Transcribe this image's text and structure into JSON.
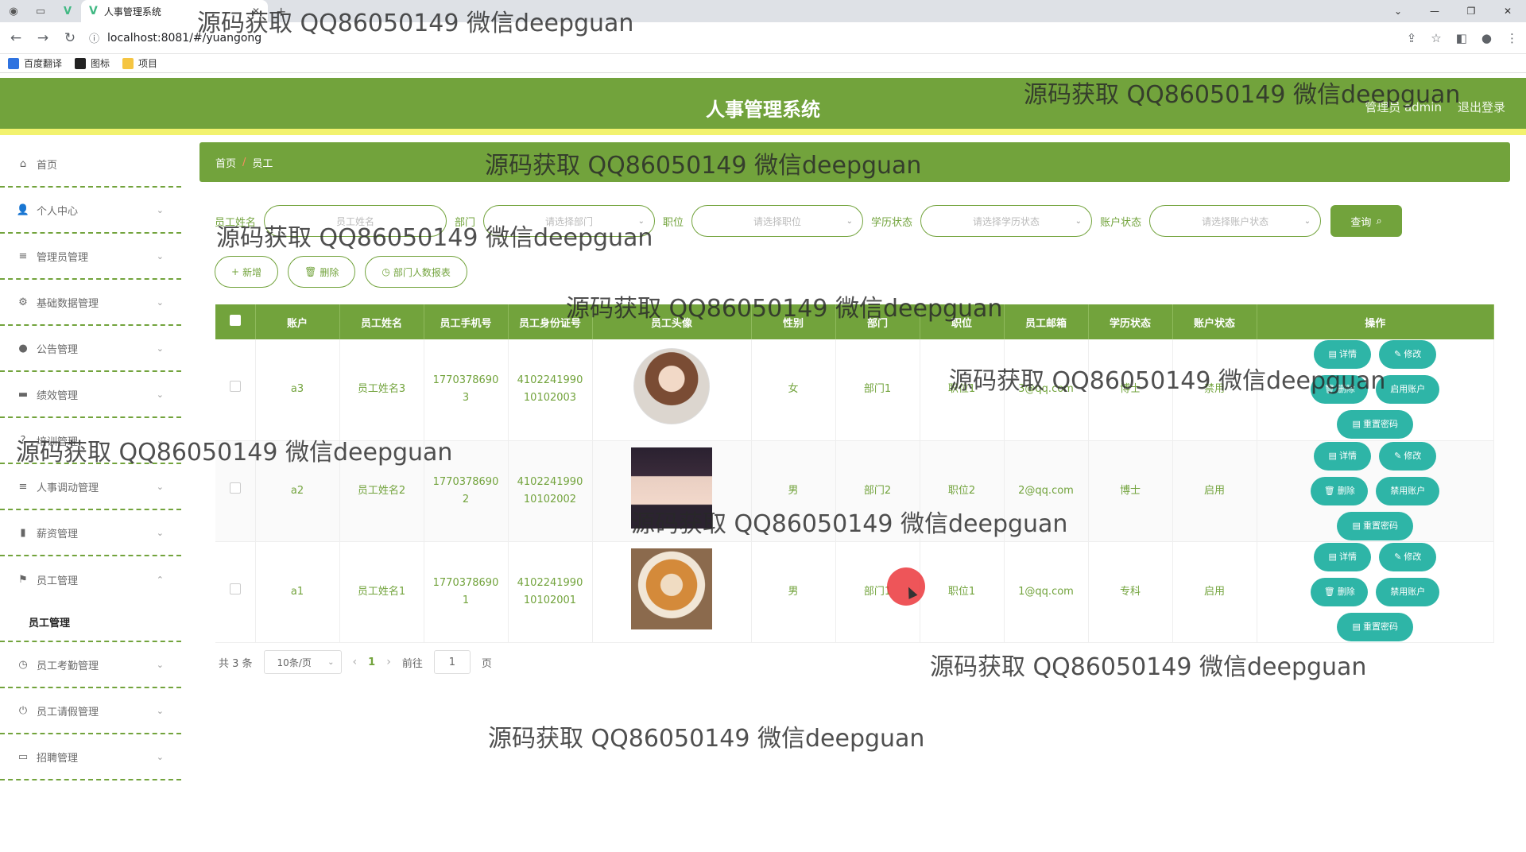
{
  "browser": {
    "tab_title": "人事管理系统",
    "url": "localhost:8081/#/yuangong",
    "bookmarks": [
      "百度翻译",
      "图标",
      "项目"
    ]
  },
  "header": {
    "title": "人事管理系统",
    "admin_label": "管理员 admin",
    "logout_label": "退出登录"
  },
  "sidebar": {
    "items": [
      {
        "label": "首页",
        "icon": "home-icon"
      },
      {
        "label": "个人中心",
        "icon": "user-icon"
      },
      {
        "label": "管理员管理",
        "icon": "list-icon"
      },
      {
        "label": "基础数据管理",
        "icon": "settings-icon"
      },
      {
        "label": "公告管理",
        "icon": "pin-icon"
      },
      {
        "label": "绩效管理",
        "icon": "message-icon"
      },
      {
        "label": "培训管理",
        "icon": "help-icon"
      },
      {
        "label": "人事调动管理",
        "icon": "list-icon"
      },
      {
        "label": "薪资管理",
        "icon": "chart-icon"
      },
      {
        "label": "员工管理",
        "icon": "flag-icon"
      },
      {
        "label": "员工管理",
        "icon": ""
      },
      {
        "label": "员工考勤管理",
        "icon": "clock-icon"
      },
      {
        "label": "员工请假管理",
        "icon": "power-icon"
      },
      {
        "label": "招聘管理",
        "icon": "card-icon"
      }
    ]
  },
  "breadcrumb": {
    "home": "首页",
    "sep": "/",
    "current": "员工"
  },
  "filters": {
    "name_label": "员工姓名",
    "name_placeholder": "员工姓名",
    "dept_label": "部门",
    "dept_placeholder": "请选择部门",
    "position_label": "职位",
    "position_placeholder": "请选择职位",
    "edu_label": "学历状态",
    "edu_placeholder": "请选择学历状态",
    "account_label": "账户状态",
    "account_placeholder": "请选择账户状态",
    "query_label": "查询"
  },
  "actions": {
    "add": "新增",
    "delete": "删除",
    "dept_stats": "部门人数报表"
  },
  "table": {
    "headers": [
      "账户",
      "员工姓名",
      "员工手机号",
      "员工身份证号",
      "员工头像",
      "性别",
      "部门",
      "职位",
      "员工邮箱",
      "学历状态",
      "账户状态",
      "操作"
    ],
    "rows": [
      {
        "account": "a3",
        "name": "员工姓名3",
        "phone1": "1770378690",
        "phone2": "3",
        "id1": "4102241990",
        "id2": "10102003",
        "gender": "女",
        "dept": "部门1",
        "position": "职位1",
        "email": "3@qq.com",
        "edu": "博士",
        "status": "禁用",
        "toggle": "启用账户"
      },
      {
        "account": "a2",
        "name": "员工姓名2",
        "phone1": "1770378690",
        "phone2": "2",
        "id1": "4102241990",
        "id2": "10102002",
        "gender": "男",
        "dept": "部门2",
        "position": "职位2",
        "email": "2@qq.com",
        "edu": "博士",
        "status": "启用",
        "toggle": "禁用账户"
      },
      {
        "account": "a1",
        "name": "员工姓名1",
        "phone1": "1770378690",
        "phone2": "1",
        "id1": "4102241990",
        "id2": "10102001",
        "gender": "男",
        "dept": "部门1",
        "position": "职位1",
        "email": "1@qq.com",
        "edu": "专科",
        "status": "启用",
        "toggle": "禁用账户"
      }
    ],
    "op_detail": "详情",
    "op_edit": "修改",
    "op_delete": "删除",
    "op_reset": "重置密码"
  },
  "pager": {
    "total": "共 3 条",
    "page_size": "10条/页",
    "current": "1",
    "goto": "前往",
    "goto_value": "1",
    "page_unit": "页"
  },
  "watermark": "源码获取 QQ86050149 微信deepguan"
}
